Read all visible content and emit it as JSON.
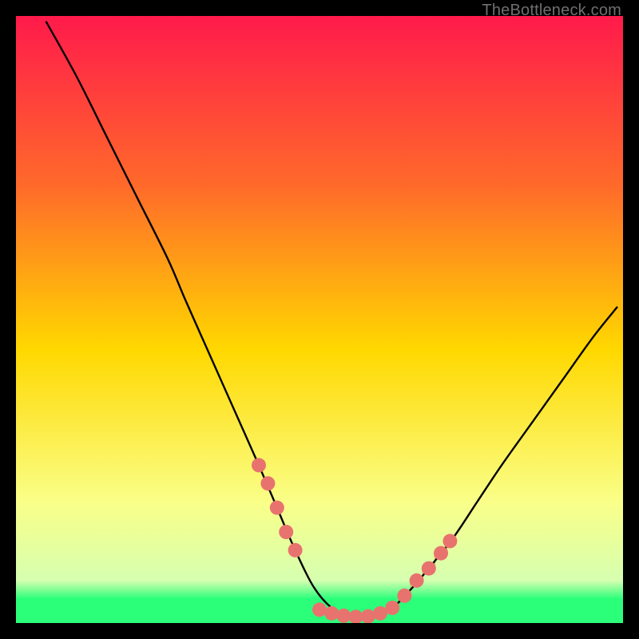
{
  "watermark": "TheBottleneck.com",
  "chart_data": {
    "type": "line",
    "title": "",
    "xlabel": "",
    "ylabel": "",
    "xlim": [
      0,
      100
    ],
    "ylim": [
      0,
      100
    ],
    "background_gradient": {
      "top": "#ff1a4b",
      "mid_upper": "#ff7a2a",
      "mid": "#ffd800",
      "mid_lower": "#f6ff6a",
      "green": "#2bff7a",
      "bottom": "#2bff7a"
    },
    "curve_color": "#000000",
    "curve_comment": "Black V-shaped bottleneck curve; y is bottleneck %, valley near x≈57",
    "curve": [
      {
        "x": 5,
        "y": 99
      },
      {
        "x": 10,
        "y": 90
      },
      {
        "x": 15,
        "y": 80
      },
      {
        "x": 20,
        "y": 70
      },
      {
        "x": 25,
        "y": 60
      },
      {
        "x": 28,
        "y": 53
      },
      {
        "x": 32,
        "y": 44
      },
      {
        "x": 36,
        "y": 35
      },
      {
        "x": 40,
        "y": 26
      },
      {
        "x": 43,
        "y": 19
      },
      {
        "x": 46,
        "y": 12
      },
      {
        "x": 49,
        "y": 6
      },
      {
        "x": 52,
        "y": 2.5
      },
      {
        "x": 55,
        "y": 1.2
      },
      {
        "x": 57,
        "y": 1.0
      },
      {
        "x": 59,
        "y": 1.2
      },
      {
        "x": 62,
        "y": 2.5
      },
      {
        "x": 65,
        "y": 5.5
      },
      {
        "x": 68,
        "y": 9
      },
      {
        "x": 72,
        "y": 14
      },
      {
        "x": 76,
        "y": 20
      },
      {
        "x": 80,
        "y": 26
      },
      {
        "x": 85,
        "y": 33
      },
      {
        "x": 90,
        "y": 40
      },
      {
        "x": 95,
        "y": 47
      },
      {
        "x": 99,
        "y": 52
      }
    ],
    "markers_color": "#e8736e",
    "markers_comment": "Salmon dot markers clustered near the valley",
    "markers": [
      {
        "x": 40,
        "y": 26
      },
      {
        "x": 41.5,
        "y": 23
      },
      {
        "x": 43,
        "y": 19
      },
      {
        "x": 44.5,
        "y": 15
      },
      {
        "x": 46,
        "y": 12
      },
      {
        "x": 50,
        "y": 2.2
      },
      {
        "x": 52,
        "y": 1.6
      },
      {
        "x": 54,
        "y": 1.2
      },
      {
        "x": 56,
        "y": 1.0
      },
      {
        "x": 58,
        "y": 1.1
      },
      {
        "x": 60,
        "y": 1.6
      },
      {
        "x": 62,
        "y": 2.5
      },
      {
        "x": 64,
        "y": 4.5
      },
      {
        "x": 66,
        "y": 7
      },
      {
        "x": 68,
        "y": 9
      },
      {
        "x": 70,
        "y": 11.5
      },
      {
        "x": 71.5,
        "y": 13.5
      }
    ],
    "ticks_comment": "Faint gold vertical tick marks along the right rising arm",
    "ticks": [
      {
        "x": 63,
        "y": 3.5
      },
      {
        "x": 64,
        "y": 4.5
      },
      {
        "x": 65,
        "y": 5.5
      },
      {
        "x": 66,
        "y": 7
      },
      {
        "x": 67,
        "y": 8
      },
      {
        "x": 68,
        "y": 9
      },
      {
        "x": 69,
        "y": 10.2
      },
      {
        "x": 70,
        "y": 11.5
      },
      {
        "x": 71,
        "y": 12.8
      }
    ]
  }
}
